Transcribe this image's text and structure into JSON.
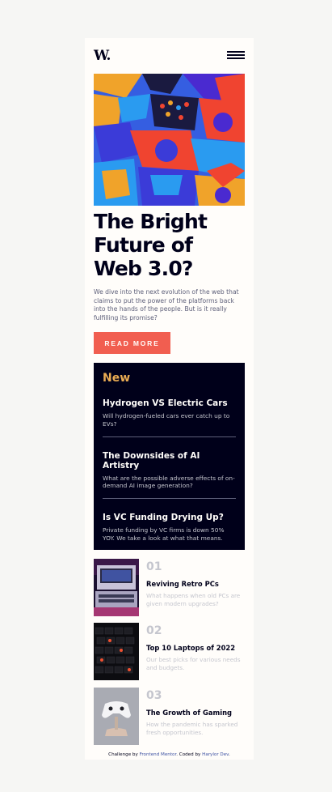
{
  "header": {
    "logo": "W.",
    "menu_icon": "hamburger-icon"
  },
  "hero": {
    "image": "abstract-3d-shapes-illustration",
    "title": "The Bright Future of Web 3.0?",
    "lead": "We dive into the next evolution of the web that claims to put the power of the platforms back into the hands of the people. But is it really fulfilling its promise?",
    "button_label": "READ MORE"
  },
  "new_section": {
    "heading": "New",
    "items": [
      {
        "title": "Hydrogen VS Electric Cars",
        "desc": "Will hydrogen-fueled cars ever catch up to EVs?"
      },
      {
        "title": "The Downsides of AI Artistry",
        "desc": "What are the possible adverse effects of on-demand AI image generation?"
      },
      {
        "title": "Is VC Funding Drying Up?",
        "desc": "Private funding by VC firms is down 50% YOY. We take a look at what that means."
      }
    ]
  },
  "numbered": [
    {
      "num": "01",
      "title": "Reviving Retro PCs",
      "desc": "What happens when old PCs are given modern upgrades?",
      "image": "retro-pc-image"
    },
    {
      "num": "02",
      "title": "Top 10 Laptops of 2022",
      "desc": "Our best picks for various needs and budgets.",
      "image": "laptop-keyboard-image"
    },
    {
      "num": "03",
      "title": "The Growth of Gaming",
      "desc": "How the pandemic has sparked fresh opportunities.",
      "image": "game-controller-image"
    }
  ],
  "footer": {
    "prefix": "Challenge by ",
    "link1": "Frontend Mentor",
    "middle": ". Coded by ",
    "link2": "Harylor Dev",
    "suffix": "."
  },
  "colors": {
    "accent_red": "#f15e50",
    "accent_orange": "#e9ab53",
    "dark_navy": "#00001a",
    "grayish_blue": "#5d5f79",
    "off_white": "#fffdfa"
  }
}
